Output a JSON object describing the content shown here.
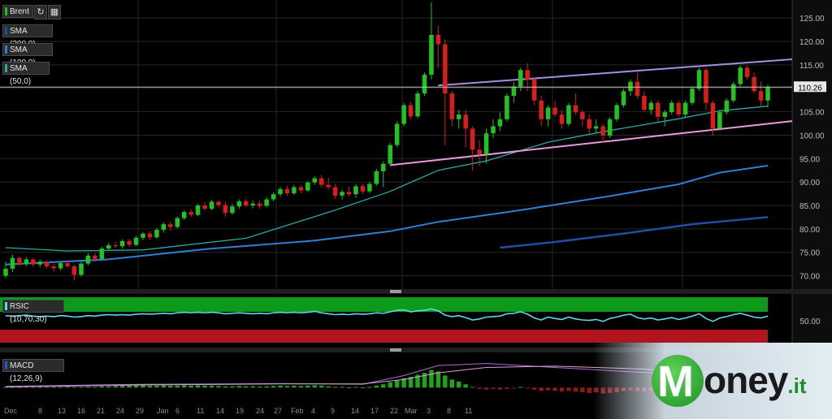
{
  "toolbar": {
    "symbol_label": "Brent",
    "reset_icon": "refresh-icon",
    "calendar_icon": "calendar-icon"
  },
  "legend": [
    {
      "label": "SMA (200,0)",
      "color": "#1f4fa3"
    },
    {
      "label": "SMA (100,0)",
      "color": "#2f7fd6"
    },
    {
      "label": "SMA (50,0)",
      "color": "#2aa9a2"
    }
  ],
  "indicators": {
    "rsi_label": "RSIC (10,70,30)",
    "rsi_tick": "50.00",
    "macd_label": "MACD (12,26,9)"
  },
  "colors": {
    "up": "#22c21f",
    "down": "#d91c1c",
    "sma50": "#2aa9a2",
    "sma100": "#2f7fd6",
    "sma200": "#1f4fa3",
    "channel_upper": "#a98be0",
    "channel_lower": "#e59ae0",
    "rsi_line": "#5fd6e8"
  },
  "brand": {
    "name_first": "M",
    "name_rest": "oney",
    "suffix": ".it"
  },
  "chart_data": {
    "type": "candlestick",
    "title": "Brent",
    "last_price": "110.26",
    "y_ticks": [
      "125.00",
      "120.00",
      "115.00",
      "110.00",
      "105.00",
      "100.00",
      "95.00",
      "90.00",
      "85.00",
      "80.00",
      "75.00",
      "70.00"
    ],
    "ylim": [
      67.5,
      128.5
    ],
    "x_ticks": [
      "Dec",
      "8",
      "13",
      "16",
      "21",
      "24",
      "29",
      "Jan",
      "6",
      "11",
      "14",
      "19",
      "24",
      "27",
      "Feb",
      "4",
      "9",
      "14",
      "17",
      "22",
      "Mar",
      "3",
      "8",
      "11"
    ],
    "candles": [
      [
        70.0,
        73.0,
        69.5,
        71.5
      ],
      [
        71.5,
        74.5,
        70.8,
        73.8
      ],
      [
        73.8,
        74.2,
        72.0,
        72.5
      ],
      [
        72.5,
        74.0,
        72.0,
        73.5
      ],
      [
        73.5,
        73.8,
        71.9,
        72.4
      ],
      [
        72.4,
        73.5,
        71.8,
        73.0
      ],
      [
        73.0,
        73.3,
        71.5,
        72.0
      ],
      [
        72.0,
        72.5,
        70.9,
        71.6
      ],
      [
        71.6,
        73.0,
        71.1,
        72.7
      ],
      [
        72.7,
        73.3,
        71.6,
        72.0
      ],
      [
        72.0,
        72.4,
        69.0,
        70.2
      ],
      [
        70.2,
        73.0,
        69.8,
        72.6
      ],
      [
        72.6,
        74.8,
        72.2,
        74.3
      ],
      [
        74.3,
        74.8,
        72.9,
        73.6
      ],
      [
        73.6,
        76.2,
        73.2,
        75.8
      ],
      [
        75.8,
        77.0,
        75.3,
        76.5
      ],
      [
        76.5,
        77.2,
        75.9,
        76.3
      ],
      [
        76.3,
        77.8,
        75.8,
        77.4
      ],
      [
        77.4,
        77.9,
        76.2,
        76.6
      ],
      [
        76.6,
        78.5,
        76.3,
        78.1
      ],
      [
        78.1,
        79.3,
        77.6,
        79.0
      ],
      [
        79.0,
        79.5,
        77.7,
        78.2
      ],
      [
        78.2,
        80.2,
        77.9,
        79.8
      ],
      [
        79.8,
        81.4,
        79.2,
        81.0
      ],
      [
        81.0,
        81.6,
        79.6,
        80.4
      ],
      [
        80.4,
        82.7,
        80.1,
        82.3
      ],
      [
        82.3,
        84.0,
        81.9,
        83.6
      ],
      [
        83.6,
        84.2,
        82.6,
        83.0
      ],
      [
        83.0,
        85.4,
        82.7,
        85.0
      ],
      [
        85.0,
        85.7,
        83.9,
        84.3
      ],
      [
        84.3,
        86.2,
        84.0,
        85.8
      ],
      [
        85.8,
        86.1,
        84.5,
        85.1
      ],
      [
        85.1,
        85.8,
        82.6,
        83.4
      ],
      [
        83.4,
        85.4,
        83.0,
        84.8
      ],
      [
        84.8,
        86.3,
        84.3,
        85.9
      ],
      [
        85.9,
        86.4,
        84.6,
        85.0
      ],
      [
        85.0,
        86.0,
        84.4,
        85.4
      ],
      [
        85.4,
        86.1,
        84.3,
        84.9
      ],
      [
        84.9,
        86.8,
        84.6,
        86.3
      ],
      [
        86.3,
        87.8,
        85.9,
        87.4
      ],
      [
        87.4,
        88.9,
        86.9,
        88.5
      ],
      [
        88.5,
        89.2,
        87.1,
        87.6
      ],
      [
        87.6,
        89.4,
        87.2,
        88.9
      ],
      [
        88.9,
        89.3,
        87.6,
        88.2
      ],
      [
        88.2,
        90.2,
        87.9,
        89.9
      ],
      [
        89.9,
        91.2,
        89.4,
        90.8
      ],
      [
        90.8,
        91.5,
        88.9,
        89.4
      ],
      [
        89.4,
        90.9,
        88.4,
        88.9
      ],
      [
        88.9,
        89.6,
        86.4,
        87.1
      ],
      [
        87.1,
        88.4,
        86.3,
        87.9
      ],
      [
        87.9,
        89.0,
        86.9,
        87.4
      ],
      [
        87.4,
        89.6,
        86.6,
        89.1
      ],
      [
        89.1,
        89.6,
        87.4,
        88.0
      ],
      [
        88.0,
        90.0,
        87.6,
        89.6
      ],
      [
        89.6,
        92.8,
        89.2,
        92.3
      ],
      [
        92.3,
        94.4,
        88.9,
        93.9
      ],
      [
        93.9,
        98.4,
        93.4,
        97.9
      ],
      [
        97.9,
        103.0,
        97.4,
        102.4
      ],
      [
        102.4,
        106.9,
        101.9,
        106.4
      ],
      [
        106.4,
        107.1,
        103.4,
        104.0
      ],
      [
        104.0,
        109.4,
        103.6,
        108.9
      ],
      [
        108.9,
        113.4,
        108.4,
        112.9
      ],
      [
        112.9,
        128.4,
        111.9,
        121.4
      ],
      [
        121.4,
        123.4,
        114.4,
        119.4
      ],
      [
        119.4,
        120.4,
        97.9,
        108.9
      ],
      [
        108.9,
        109.4,
        101.9,
        103.4
      ],
      [
        103.4,
        105.4,
        101.4,
        104.4
      ],
      [
        104.4,
        105.4,
        97.4,
        101.4
      ],
      [
        101.4,
        101.9,
        92.4,
        96.9
      ],
      [
        96.9,
        98.9,
        93.4,
        95.9
      ],
      [
        95.9,
        101.4,
        93.9,
        100.4
      ],
      [
        100.4,
        103.4,
        99.4,
        101.9
      ],
      [
        101.9,
        104.9,
        100.9,
        103.4
      ],
      [
        103.4,
        108.9,
        102.9,
        108.4
      ],
      [
        108.4,
        111.4,
        106.9,
        110.4
      ],
      [
        110.4,
        114.4,
        109.4,
        113.9
      ],
      [
        113.9,
        115.4,
        109.4,
        111.9
      ],
      [
        111.9,
        112.4,
        106.4,
        107.4
      ],
      [
        107.4,
        108.4,
        101.9,
        103.4
      ],
      [
        103.4,
        106.4,
        101.9,
        105.9
      ],
      [
        105.9,
        107.4,
        103.9,
        104.4
      ],
      [
        104.4,
        105.4,
        101.4,
        102.4
      ],
      [
        102.4,
        106.9,
        101.9,
        106.4
      ],
      [
        106.4,
        108.9,
        104.4,
        104.9
      ],
      [
        104.9,
        105.4,
        101.9,
        103.4
      ],
      [
        103.4,
        104.4,
        100.4,
        101.4
      ],
      [
        101.4,
        103.4,
        100.4,
        101.9
      ],
      [
        101.9,
        102.4,
        98.4,
        99.9
      ],
      [
        99.9,
        103.9,
        99.4,
        103.4
      ],
      [
        103.4,
        106.9,
        102.9,
        106.4
      ],
      [
        106.4,
        109.9,
        105.9,
        109.4
      ],
      [
        109.4,
        111.9,
        108.4,
        111.4
      ],
      [
        111.4,
        113.4,
        107.9,
        108.4
      ],
      [
        108.4,
        109.4,
        104.9,
        105.4
      ],
      [
        105.4,
        107.4,
        104.4,
        106.9
      ],
      [
        106.9,
        107.4,
        102.9,
        103.9
      ],
      [
        103.9,
        105.4,
        101.9,
        104.9
      ],
      [
        104.9,
        107.4,
        104.4,
        106.9
      ],
      [
        106.9,
        107.4,
        103.9,
        104.4
      ],
      [
        104.4,
        107.4,
        103.9,
        106.9
      ],
      [
        106.9,
        110.4,
        106.4,
        109.9
      ],
      [
        109.9,
        114.4,
        109.4,
        113.9
      ],
      [
        113.9,
        114.4,
        105.4,
        106.9
      ],
      [
        106.9,
        107.4,
        99.9,
        101.4
      ],
      [
        101.4,
        105.4,
        100.9,
        104.9
      ],
      [
        104.9,
        107.9,
        104.4,
        107.4
      ],
      [
        107.4,
        111.4,
        106.9,
        110.9
      ],
      [
        110.9,
        114.9,
        110.4,
        114.4
      ],
      [
        114.4,
        114.9,
        111.9,
        112.4
      ],
      [
        112.4,
        113.4,
        108.9,
        109.4
      ],
      [
        109.4,
        111.4,
        105.9,
        107.4
      ],
      [
        107.4,
        110.8,
        105.9,
        110.26
      ]
    ],
    "sma50": [
      [
        0,
        76.0
      ],
      [
        9,
        75.3
      ],
      [
        20,
        75.5
      ],
      [
        35,
        78.0
      ],
      [
        48,
        84.0
      ],
      [
        56,
        88.0
      ],
      [
        63,
        92.5
      ],
      [
        70,
        94.5
      ],
      [
        79,
        98.5
      ],
      [
        88,
        101.0
      ],
      [
        98,
        103.5
      ],
      [
        104,
        105.2
      ],
      [
        111,
        106.2
      ]
    ],
    "sma100": [
      [
        0,
        72.4
      ],
      [
        15,
        73.5
      ],
      [
        30,
        75.8
      ],
      [
        45,
        77.5
      ],
      [
        56,
        79.5
      ],
      [
        63,
        81.5
      ],
      [
        75,
        84.0
      ],
      [
        88,
        87.0
      ],
      [
        98,
        89.5
      ],
      [
        104,
        92.0
      ],
      [
        111,
        93.5
      ]
    ],
    "sma200": [
      [
        72,
        76.0
      ],
      [
        80,
        77.2
      ],
      [
        90,
        79.0
      ],
      [
        100,
        81.0
      ],
      [
        111,
        82.5
      ]
    ],
    "channel_upper": [
      [
        63,
        110.6
      ],
      [
        111,
        115.6
      ]
    ],
    "channel_lower": [
      [
        56,
        93.6
      ],
      [
        111,
        102.6
      ]
    ],
    "rsi": {
      "ylim": [
        -2,
        100
      ],
      "overbought": 70,
      "oversold": 30,
      "values": [
        58,
        57,
        58,
        59,
        57,
        56,
        57,
        56,
        58,
        57,
        55,
        56,
        58,
        57,
        59,
        60,
        59,
        60,
        59,
        61,
        62,
        61,
        62,
        63,
        62,
        64,
        65,
        64,
        65,
        64,
        65,
        64,
        62,
        63,
        64,
        63,
        62,
        63,
        62,
        64,
        65,
        64,
        65,
        64,
        65,
        67,
        64,
        62,
        60,
        61,
        60,
        62,
        61,
        62,
        64,
        63,
        66,
        69,
        70,
        66,
        68,
        69,
        72,
        68,
        59,
        56,
        58,
        54,
        49,
        51,
        55,
        56,
        57,
        62,
        63,
        66,
        61,
        53,
        49,
        55,
        52,
        50,
        55,
        51,
        49,
        48,
        50,
        46,
        52,
        55,
        59,
        61,
        54,
        51,
        53,
        49,
        51,
        54,
        50,
        53,
        57,
        62,
        52,
        46,
        53,
        56,
        60,
        63,
        59,
        55,
        53,
        57
      ]
    },
    "macd": {
      "ylim": [
        -2.5,
        5.0
      ],
      "histogram": [
        0.1,
        0.1,
        0.1,
        0.15,
        0.15,
        0.1,
        0.1,
        0.1,
        0.1,
        0.15,
        0.1,
        0.1,
        0.15,
        0.1,
        0.2,
        0.2,
        0.25,
        0.3,
        0.3,
        0.35,
        0.35,
        0.3,
        0.3,
        0.35,
        0.3,
        0.3,
        0.35,
        0.3,
        0.35,
        0.3,
        0.3,
        0.25,
        0.2,
        0.2,
        0.25,
        0.2,
        0.2,
        0.15,
        0.2,
        0.25,
        0.3,
        0.25,
        0.3,
        0.25,
        0.3,
        0.35,
        0.3,
        0.2,
        0.1,
        0.1,
        0.05,
        0.1,
        0.05,
        0.1,
        0.3,
        0.5,
        0.8,
        1.1,
        1.4,
        1.6,
        1.9,
        2.2,
        2.6,
        2.4,
        1.8,
        1.2,
        0.9,
        0.5,
        0.1,
        -0.2,
        -0.3,
        -0.2,
        -0.3,
        -0.2,
        -0.1,
        0.1,
        -0.1,
        -0.3,
        -0.5,
        -0.4,
        -0.5,
        -0.6,
        -0.5,
        -0.6,
        -0.7,
        -0.8,
        -0.7,
        -0.9,
        -0.8,
        -0.7,
        -0.5,
        -0.4,
        -0.5,
        -0.6,
        -0.5,
        -0.6,
        -0.5,
        -0.4,
        -0.5,
        -0.4,
        -0.3,
        -0.2,
        -0.4,
        -0.5,
        -0.4,
        -0.3,
        -0.2,
        -0.1,
        -0.2,
        -0.3,
        -0.3,
        -0.2
      ],
      "macd_line": [
        [
          0,
          0.2
        ],
        [
          20,
          0.5
        ],
        [
          40,
          0.6
        ],
        [
          52,
          0.5
        ],
        [
          58,
          1.8
        ],
        [
          63,
          3.3
        ],
        [
          70,
          3.6
        ],
        [
          80,
          3.0
        ],
        [
          92,
          2.3
        ],
        [
          104,
          1.8
        ],
        [
          111,
          1.7
        ]
      ],
      "signal_line": [
        [
          0,
          0.1
        ],
        [
          20,
          0.4
        ],
        [
          40,
          0.55
        ],
        [
          52,
          0.55
        ],
        [
          58,
          1.2
        ],
        [
          63,
          2.2
        ],
        [
          70,
          3.0
        ],
        [
          80,
          3.2
        ],
        [
          92,
          2.8
        ],
        [
          104,
          2.2
        ],
        [
          111,
          2.0
        ]
      ]
    }
  }
}
